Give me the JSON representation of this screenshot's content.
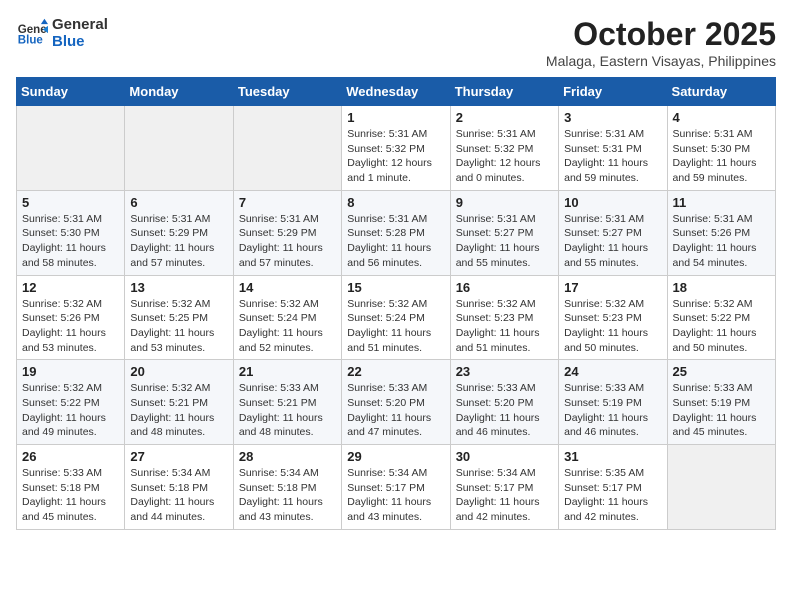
{
  "header": {
    "logo_line1": "General",
    "logo_line2": "Blue",
    "month": "October 2025",
    "location": "Malaga, Eastern Visayas, Philippines"
  },
  "weekdays": [
    "Sunday",
    "Monday",
    "Tuesday",
    "Wednesday",
    "Thursday",
    "Friday",
    "Saturday"
  ],
  "weeks": [
    [
      {
        "day": "",
        "info": ""
      },
      {
        "day": "",
        "info": ""
      },
      {
        "day": "",
        "info": ""
      },
      {
        "day": "1",
        "info": "Sunrise: 5:31 AM\nSunset: 5:32 PM\nDaylight: 12 hours\nand 1 minute."
      },
      {
        "day": "2",
        "info": "Sunrise: 5:31 AM\nSunset: 5:32 PM\nDaylight: 12 hours\nand 0 minutes."
      },
      {
        "day": "3",
        "info": "Sunrise: 5:31 AM\nSunset: 5:31 PM\nDaylight: 11 hours\nand 59 minutes."
      },
      {
        "day": "4",
        "info": "Sunrise: 5:31 AM\nSunset: 5:30 PM\nDaylight: 11 hours\nand 59 minutes."
      }
    ],
    [
      {
        "day": "5",
        "info": "Sunrise: 5:31 AM\nSunset: 5:30 PM\nDaylight: 11 hours\nand 58 minutes."
      },
      {
        "day": "6",
        "info": "Sunrise: 5:31 AM\nSunset: 5:29 PM\nDaylight: 11 hours\nand 57 minutes."
      },
      {
        "day": "7",
        "info": "Sunrise: 5:31 AM\nSunset: 5:29 PM\nDaylight: 11 hours\nand 57 minutes."
      },
      {
        "day": "8",
        "info": "Sunrise: 5:31 AM\nSunset: 5:28 PM\nDaylight: 11 hours\nand 56 minutes."
      },
      {
        "day": "9",
        "info": "Sunrise: 5:31 AM\nSunset: 5:27 PM\nDaylight: 11 hours\nand 55 minutes."
      },
      {
        "day": "10",
        "info": "Sunrise: 5:31 AM\nSunset: 5:27 PM\nDaylight: 11 hours\nand 55 minutes."
      },
      {
        "day": "11",
        "info": "Sunrise: 5:31 AM\nSunset: 5:26 PM\nDaylight: 11 hours\nand 54 minutes."
      }
    ],
    [
      {
        "day": "12",
        "info": "Sunrise: 5:32 AM\nSunset: 5:26 PM\nDaylight: 11 hours\nand 53 minutes."
      },
      {
        "day": "13",
        "info": "Sunrise: 5:32 AM\nSunset: 5:25 PM\nDaylight: 11 hours\nand 53 minutes."
      },
      {
        "day": "14",
        "info": "Sunrise: 5:32 AM\nSunset: 5:24 PM\nDaylight: 11 hours\nand 52 minutes."
      },
      {
        "day": "15",
        "info": "Sunrise: 5:32 AM\nSunset: 5:24 PM\nDaylight: 11 hours\nand 51 minutes."
      },
      {
        "day": "16",
        "info": "Sunrise: 5:32 AM\nSunset: 5:23 PM\nDaylight: 11 hours\nand 51 minutes."
      },
      {
        "day": "17",
        "info": "Sunrise: 5:32 AM\nSunset: 5:23 PM\nDaylight: 11 hours\nand 50 minutes."
      },
      {
        "day": "18",
        "info": "Sunrise: 5:32 AM\nSunset: 5:22 PM\nDaylight: 11 hours\nand 50 minutes."
      }
    ],
    [
      {
        "day": "19",
        "info": "Sunrise: 5:32 AM\nSunset: 5:22 PM\nDaylight: 11 hours\nand 49 minutes."
      },
      {
        "day": "20",
        "info": "Sunrise: 5:32 AM\nSunset: 5:21 PM\nDaylight: 11 hours\nand 48 minutes."
      },
      {
        "day": "21",
        "info": "Sunrise: 5:33 AM\nSunset: 5:21 PM\nDaylight: 11 hours\nand 48 minutes."
      },
      {
        "day": "22",
        "info": "Sunrise: 5:33 AM\nSunset: 5:20 PM\nDaylight: 11 hours\nand 47 minutes."
      },
      {
        "day": "23",
        "info": "Sunrise: 5:33 AM\nSunset: 5:20 PM\nDaylight: 11 hours\nand 46 minutes."
      },
      {
        "day": "24",
        "info": "Sunrise: 5:33 AM\nSunset: 5:19 PM\nDaylight: 11 hours\nand 46 minutes."
      },
      {
        "day": "25",
        "info": "Sunrise: 5:33 AM\nSunset: 5:19 PM\nDaylight: 11 hours\nand 45 minutes."
      }
    ],
    [
      {
        "day": "26",
        "info": "Sunrise: 5:33 AM\nSunset: 5:18 PM\nDaylight: 11 hours\nand 45 minutes."
      },
      {
        "day": "27",
        "info": "Sunrise: 5:34 AM\nSunset: 5:18 PM\nDaylight: 11 hours\nand 44 minutes."
      },
      {
        "day": "28",
        "info": "Sunrise: 5:34 AM\nSunset: 5:18 PM\nDaylight: 11 hours\nand 43 minutes."
      },
      {
        "day": "29",
        "info": "Sunrise: 5:34 AM\nSunset: 5:17 PM\nDaylight: 11 hours\nand 43 minutes."
      },
      {
        "day": "30",
        "info": "Sunrise: 5:34 AM\nSunset: 5:17 PM\nDaylight: 11 hours\nand 42 minutes."
      },
      {
        "day": "31",
        "info": "Sunrise: 5:35 AM\nSunset: 5:17 PM\nDaylight: 11 hours\nand 42 minutes."
      },
      {
        "day": "",
        "info": ""
      }
    ]
  ]
}
